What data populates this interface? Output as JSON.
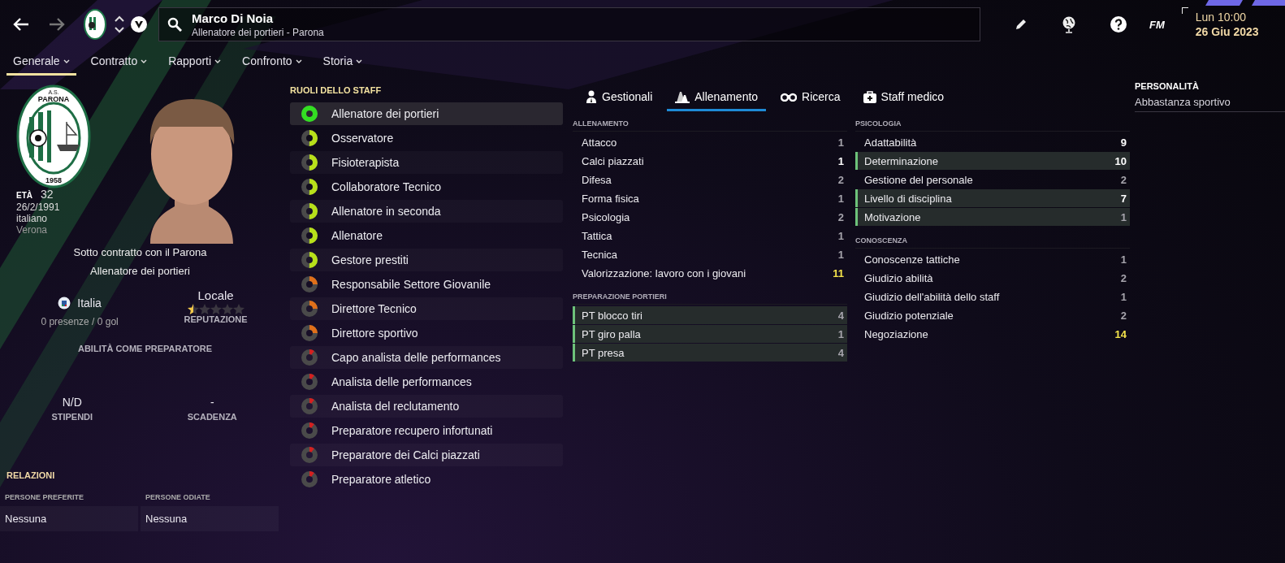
{
  "topbar": {
    "name": "Marco Di Noia",
    "subtitle": "Allenatore dei portieri - Parona",
    "logo": "FM",
    "clock": {
      "time": "Lun 10:00",
      "date": "26 Giu 2023"
    }
  },
  "nav": [
    {
      "label": "Generale",
      "selected": true
    },
    {
      "label": "Contratto",
      "selected": false
    },
    {
      "label": "Rapporti",
      "selected": false
    },
    {
      "label": "Confronto",
      "selected": false
    },
    {
      "label": "Storia",
      "selected": false
    }
  ],
  "profile": {
    "crest": {
      "top": "A.S.",
      "name": "PARONA",
      "year": "1958"
    },
    "age_label": "ETÀ",
    "age": "32",
    "birth_date": "26/2/1991",
    "nationality": "italiano",
    "birthplace": "Verona",
    "contract": "Sotto contratto con il Parona",
    "role": "Allenatore dei portieri",
    "nation": "Italia",
    "caps": "0 presenze / 0 gol",
    "reputation": {
      "value": "Locale",
      "stars": 0.5,
      "label": "REPUTAZIONE"
    },
    "ability_heading": "ABILITÀ COME PREPARATORE",
    "wage": {
      "value": "N/D",
      "label": "STIPENDI"
    },
    "expiry": {
      "value": "-",
      "label": "SCADENZA"
    }
  },
  "relations": {
    "title": "RELAZIONI",
    "favoured": {
      "label": "PERSONE PREFERITE",
      "value": "Nessuna"
    },
    "disliked": {
      "label": "PERSONE ODIATE",
      "value": "Nessuna"
    }
  },
  "staff_roles": {
    "title": "RUOLI DELLO STAFF",
    "items": [
      {
        "name": "Allenatore dei portieri",
        "level": 1,
        "color": "#33dd22",
        "selected": true
      },
      {
        "name": "Osservatore",
        "level": 0.5,
        "color": "#b8e01a",
        "selected": false
      },
      {
        "name": "Fisioterapista",
        "level": 0.5,
        "color": "#b8e01a",
        "selected": false
      },
      {
        "name": "Collaboratore Tecnico",
        "level": 0.5,
        "color": "#b8e01a",
        "selected": false
      },
      {
        "name": "Allenatore in seconda",
        "level": 0.5,
        "color": "#b8e01a",
        "selected": false
      },
      {
        "name": "Allenatore",
        "level": 0.5,
        "color": "#b8e01a",
        "selected": false
      },
      {
        "name": "Gestore prestiti",
        "level": 0.5,
        "color": "#b8e01a",
        "selected": false
      },
      {
        "name": "Responsabile Settore Giovanile",
        "level": 0.25,
        "color": "#e0701a",
        "selected": false
      },
      {
        "name": "Direttore Tecnico",
        "level": 0.25,
        "color": "#e0701a",
        "selected": false
      },
      {
        "name": "Direttore sportivo",
        "level": 0.25,
        "color": "#e0701a",
        "selected": false
      },
      {
        "name": "Capo analista delle performances",
        "level": 0.1,
        "color": "#d42020",
        "selected": false
      },
      {
        "name": "Analista delle performances",
        "level": 0.1,
        "color": "#d42020",
        "selected": false
      },
      {
        "name": "Analista del reclutamento",
        "level": 0.1,
        "color": "#d42020",
        "selected": false
      },
      {
        "name": "Preparatore recupero infortunati",
        "level": 0.1,
        "color": "#d42020",
        "selected": false
      },
      {
        "name": "Preparatore dei Calci piazzati",
        "level": 0.1,
        "color": "#d42020",
        "selected": false
      },
      {
        "name": "Preparatore atletico",
        "level": 0.1,
        "color": "#d42020",
        "selected": false
      }
    ]
  },
  "attribute_tabs": [
    {
      "label": "Gestionali",
      "selected": false
    },
    {
      "label": "Allenamento",
      "selected": true
    },
    {
      "label": "Ricerca",
      "selected": false
    },
    {
      "label": "Staff medico",
      "selected": false
    }
  ],
  "attribute_columns": [
    [
      {
        "title": "ALLENAMENTO",
        "rows": [
          {
            "name": "Attacco",
            "value": "1",
            "color": "#a6a4ac",
            "key": false
          },
          {
            "name": "Calci piazzati",
            "value": "1",
            "color": "#ffffff",
            "key": false
          },
          {
            "name": "Difesa",
            "value": "2",
            "color": "#a6a4ac",
            "key": false
          },
          {
            "name": "Forma fisica",
            "value": "1",
            "color": "#a6a4ac",
            "key": false
          },
          {
            "name": "Psicologia",
            "value": "2",
            "color": "#a6a4ac",
            "key": false
          },
          {
            "name": "Tattica",
            "value": "1",
            "color": "#a6a4ac",
            "key": false
          },
          {
            "name": "Tecnica",
            "value": "1",
            "color": "#a6a4ac",
            "key": false
          },
          {
            "name": "Valorizzazione: lavoro con i giovani",
            "value": "11",
            "color": "#f3e24a",
            "key": false
          }
        ]
      },
      {
        "title": "PREPARAZIONE PORTIERI",
        "rows": [
          {
            "name": "PT blocco tiri",
            "value": "4",
            "color": "#a6a4ac",
            "key": true
          },
          {
            "name": "PT giro palla",
            "value": "1",
            "color": "#a6a4ac",
            "key": true
          },
          {
            "name": "PT presa",
            "value": "4",
            "color": "#a6a4ac",
            "key": true
          }
        ]
      }
    ],
    [
      {
        "title": "PSICOLOGIA",
        "rows": [
          {
            "name": "Adattabilità",
            "value": "9",
            "color": "#ffffff",
            "key": false
          },
          {
            "name": "Determinazione",
            "value": "10",
            "color": "#ffffff",
            "key": true
          },
          {
            "name": "Gestione del personale",
            "value": "2",
            "color": "#a6a4ac",
            "key": false
          },
          {
            "name": "Livello di disciplina",
            "value": "7",
            "color": "#ffffff",
            "key": true
          },
          {
            "name": "Motivazione",
            "value": "1",
            "color": "#a6a4ac",
            "key": true
          }
        ]
      },
      {
        "title": "CONOSCENZA",
        "rows": [
          {
            "name": "Conoscenze tattiche",
            "value": "1",
            "color": "#a6a4ac",
            "key": false
          },
          {
            "name": "Giudizio abilità",
            "value": "2",
            "color": "#a6a4ac",
            "key": false
          },
          {
            "name": "Giudizio dell'abilità dello staff",
            "value": "1",
            "color": "#a6a4ac",
            "key": false
          },
          {
            "name": "Giudizio potenziale",
            "value": "2",
            "color": "#a6a4ac",
            "key": false
          },
          {
            "name": "Negoziazione",
            "value": "14",
            "color": "#f3e24a",
            "key": false
          }
        ]
      }
    ]
  ],
  "personality": {
    "title": "PERSONALITÀ",
    "value": "Abbastanza sportivo"
  }
}
